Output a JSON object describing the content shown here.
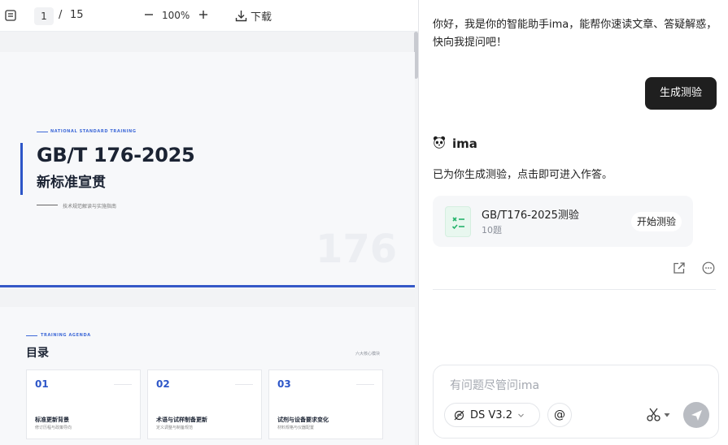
{
  "toolbar": {
    "page_current": "1",
    "page_sep": "/",
    "page_total": "15",
    "zoom": "100%",
    "download_label": "下载"
  },
  "slide1": {
    "tag": "NATIONAL STANDARD TRAINING",
    "title": "GB/T 176-2025",
    "subtitle": "新标准宣贯",
    "note": "技术规范解读与实施指南",
    "watermark": "176"
  },
  "slide2": {
    "tag": "TRAINING AGENDA",
    "title": "目录",
    "right_note": "六大核心模块",
    "cards": [
      {
        "num": "01",
        "title": "标准更新背景",
        "sub": "修订历程与政策导向"
      },
      {
        "num": "02",
        "title": "术语与试样制备更新",
        "sub": "定义调整与制备规范"
      },
      {
        "num": "03",
        "title": "试剂与设备要求变化",
        "sub": "材料规格与仪器配置"
      }
    ]
  },
  "chat": {
    "greeting": "你好，我是你的智能助手ima，能帮你速读文章、答疑解惑，快向我提问吧！",
    "user_message": "生成测验",
    "assistant_name": "ima",
    "reply": "已为你生成测验，点击即可进入作答。",
    "quiz": {
      "title": "GB/T176-2025测验",
      "count": "10题",
      "start_label": "开始测验"
    },
    "composer": {
      "placeholder": "有问题尽管问ima",
      "model": "DS V3.2",
      "at": "@"
    }
  },
  "colors": {
    "accent_blue": "#2d56c8",
    "user_bubble": "#1f1f1f",
    "send_disabled": "#b9bcc2"
  }
}
